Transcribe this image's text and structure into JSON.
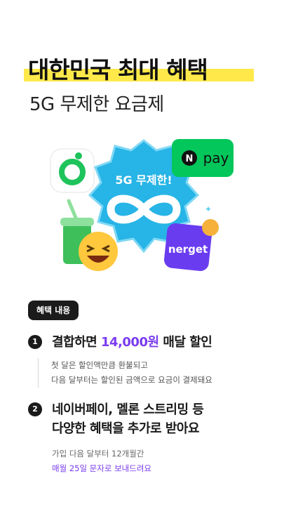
{
  "hero": {
    "title": "대한민국 최대 혜택",
    "subtitle": "5G 무제한 요금제"
  },
  "illustration": {
    "badge_text": "5G 무제한!",
    "npay_n": "N",
    "npay_text": "pay",
    "nerget_text": "nerget"
  },
  "benefits_label": "혜택 내용",
  "items": [
    {
      "number": "1",
      "title_pre": "결합하면 ",
      "title_accent": "14,000원",
      "title_post": " 매달 할인",
      "lines": [
        "첫 달은 할인액만큼 환불되고",
        "다음 달부터는 할인된 금액으로 요금이 결제돼요"
      ]
    },
    {
      "number": "2",
      "title_line1": "네이버페이, 멜론 스트리밍 등",
      "title_line2": "다양한 혜택을 추가로 받아요",
      "line1": "가입 다음 달부터 12개월간",
      "line2_accent": "매월 25일 문자로 보내드려요"
    }
  ],
  "colors": {
    "highlight": "#ffe94a",
    "accent": "#7a3cf0",
    "badge": "#27b4e6",
    "npay": "#03c75a",
    "nerget": "#6a3cf0"
  }
}
